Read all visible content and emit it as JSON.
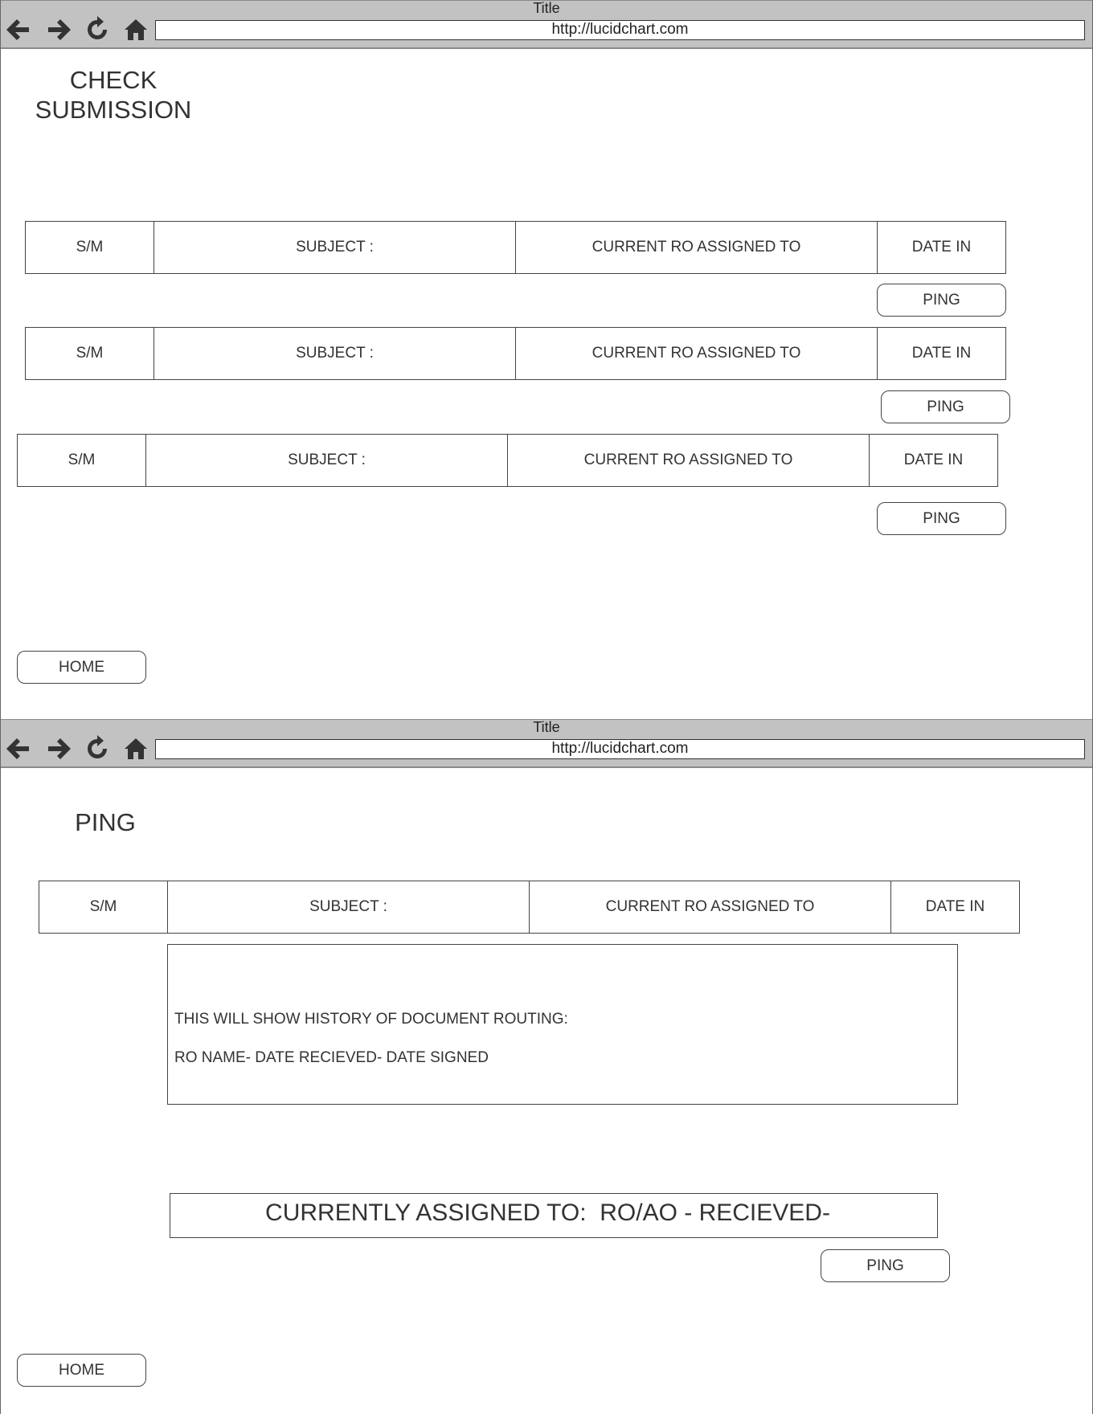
{
  "browser": {
    "window_title": "Title",
    "url": "http://lucidchart.com"
  },
  "screen1": {
    "heading_line1": "CHECK",
    "heading_line2": "SUBMISSION",
    "rows": [
      {
        "sm": "S/M",
        "subject": "SUBJECT :",
        "ro": "CURRENT RO ASSIGNED TO",
        "date": "DATE IN",
        "ping": "PING"
      },
      {
        "sm": "S/M",
        "subject": "SUBJECT :",
        "ro": "CURRENT RO ASSIGNED TO",
        "date": "DATE IN",
        "ping": "PING"
      },
      {
        "sm": "S/M",
        "subject": "SUBJECT :",
        "ro": "CURRENT RO ASSIGNED TO",
        "date": "DATE IN",
        "ping": "PING"
      }
    ],
    "home_label": "HOME"
  },
  "screen2": {
    "heading": "PING",
    "row": {
      "sm": "S/M",
      "subject": "SUBJECT :",
      "ro": "CURRENT RO ASSIGNED TO",
      "date": "DATE IN"
    },
    "history_line1": "THIS WILL SHOW HISTORY OF DOCUMENT ROUTING:",
    "history_line2": "RO NAME- DATE RECIEVED- DATE SIGNED",
    "assigned_text": "CURRENTLY ASSIGNED TO:  RO/AO - RECIEVED-",
    "ping_label": "PING",
    "home_label": "HOME"
  },
  "icons": [
    "back-arrow-icon",
    "forward-arrow-icon",
    "reload-icon",
    "home-icon"
  ]
}
